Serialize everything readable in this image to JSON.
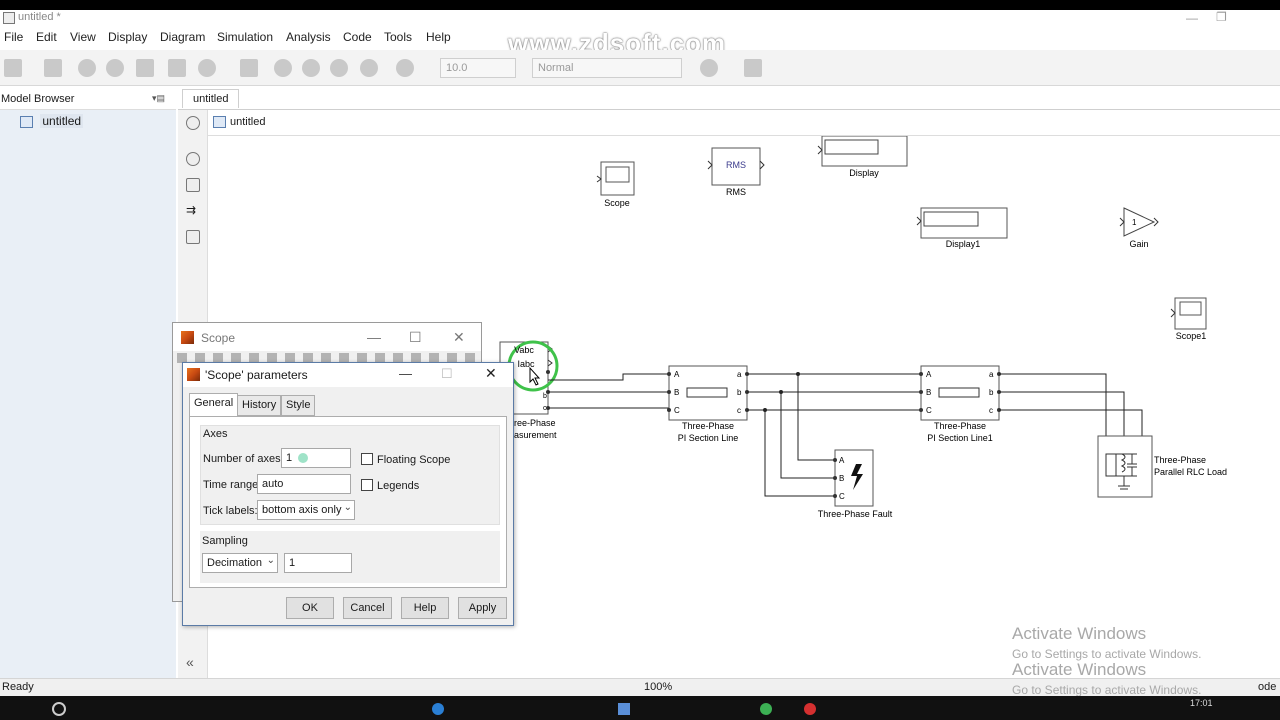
{
  "window": {
    "title": "untitled *"
  },
  "watermark": "www.zdsoft.com",
  "menu": [
    "File",
    "Edit",
    "View",
    "Display",
    "Diagram",
    "Simulation",
    "Analysis",
    "Code",
    "Tools",
    "Help"
  ],
  "toolbar": {
    "stop_time": "10.0",
    "sim_mode": "Normal"
  },
  "model_browser": {
    "title": "Model Browser",
    "items": [
      "untitled"
    ]
  },
  "tabs": [
    "untitled"
  ],
  "breadcrumb": "untitled",
  "blocks": {
    "scope": "Scope",
    "rms": "RMS",
    "rms_body": "RMS",
    "display": "Display",
    "display1": "Display1",
    "gain": "Gain",
    "gain_value": "1",
    "scope1": "Scope1",
    "vi_meas": "ree-Phase",
    "vi_meas2": "asurement",
    "vabc": "Vabc",
    "iabc": "Iabc",
    "pi1a": "Three-Phase",
    "pi1b": "PI Section Line",
    "pi2a": "Three-Phase",
    "pi2b": "PI Section Line1",
    "fault": "Three-Phase Fault",
    "rlc_a": "Three-Phase",
    "rlc_b": "Parallel RLC Load",
    "port_A": "A",
    "port_B": "B",
    "port_C": "C",
    "port_a": "a",
    "port_b": "b",
    "port_c": "c"
  },
  "scope_window": {
    "title": "Scope"
  },
  "dialog": {
    "title": "'Scope' parameters",
    "tabs": [
      "General",
      "History",
      "Style"
    ],
    "axes_group": "Axes",
    "num_axes_label": "Number of axes:",
    "num_axes_value": "1",
    "floating_scope": "Floating Scope",
    "time_range_label": "Time range:",
    "time_range_value": "auto",
    "legends": "Legends",
    "tick_labels_label": "Tick labels:",
    "tick_labels_value": "bottom axis only",
    "sampling_group": "Sampling",
    "sampling_mode": "Decimation",
    "sampling_value": "1",
    "buttons": {
      "ok": "OK",
      "cancel": "Cancel",
      "help": "Help",
      "apply": "Apply"
    }
  },
  "status": {
    "left": "Ready",
    "zoom": "100%",
    "right": "ode"
  },
  "activation": {
    "line1": "Activate Windows",
    "line2": "Go to Settings to activate Windows.",
    "line3": "Activate Windows",
    "line4": "Go to Settings to activate Windows."
  },
  "clock": "17:01"
}
